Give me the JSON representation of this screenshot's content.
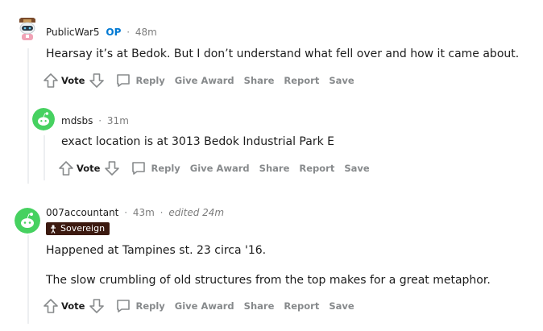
{
  "comments": [
    {
      "author": "PublicWar5",
      "op_badge": "OP",
      "time": "48m",
      "text": "Hearsay it’s at Bedok. But I don’t understand what fell over and how it came about.",
      "actions": {
        "vote": "Vote",
        "reply": "Reply",
        "give_award": "Give Award",
        "share": "Share",
        "report": "Report",
        "save": "Save"
      }
    },
    {
      "author": "mdsbs",
      "time": "31m",
      "text": "exact location is at 3013 Bedok Industrial Park E",
      "actions": {
        "vote": "Vote",
        "reply": "Reply",
        "give_award": "Give Award",
        "share": "Share",
        "report": "Report",
        "save": "Save"
      }
    },
    {
      "author": "007accountant",
      "time": "43m",
      "edited": "edited 24m",
      "flair": "Sovereign",
      "text_lines": [
        "Happened at Tampines st. 23 circa '16.",
        "The slow crumbling of old structures from the top makes for a great metaphor."
      ],
      "actions": {
        "vote": "Vote",
        "reply": "Reply",
        "give_award": "Give Award",
        "share": "Share",
        "report": "Report",
        "save": "Save"
      }
    }
  ],
  "colors": {
    "op": "#0079d3",
    "meta": "#7c7c7c",
    "action": "#878a8c",
    "flair_bg": "#3c1a10",
    "snoo_green": "#46d160"
  }
}
